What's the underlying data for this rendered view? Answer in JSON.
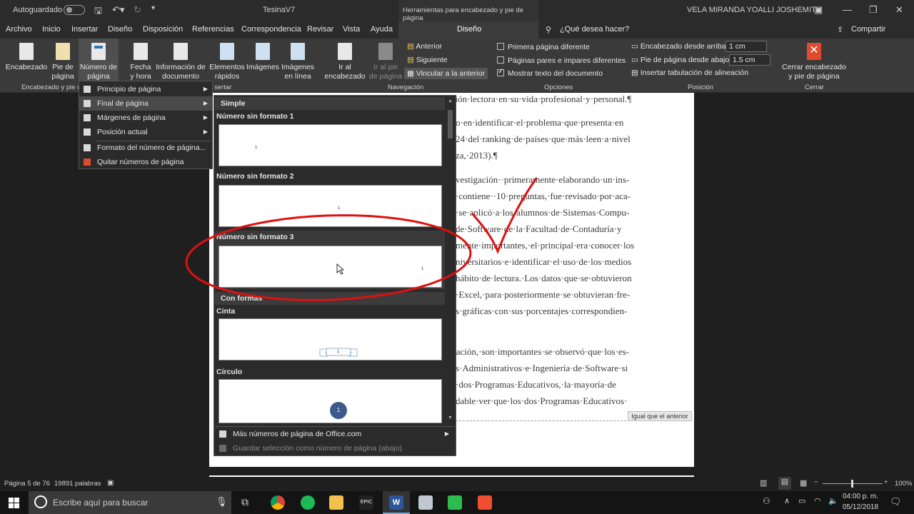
{
  "titlebar": {
    "autosave_label": "Autoguardado",
    "doc_title": "TesinaV7",
    "context_header": "Herramientas para encabezado y pie de página",
    "user_name": "VELA MIRANDA YOALLI JOSHEMITH"
  },
  "tabs": [
    "Archivo",
    "Inicio",
    "Insertar",
    "Diseño",
    "Disposición",
    "Referencias",
    "Correspondencia",
    "Revisar",
    "Vista",
    "Ayuda"
  ],
  "context_tab": "Diseño",
  "tell_me": "¿Qué desea hacer?",
  "share": "Compartir",
  "ribbon": {
    "encabezado": "Encabezado",
    "pie": "Pie de\npágina",
    "numero": "Número de\npágina",
    "fecha": "Fecha\ny hora",
    "info_doc": "Información de\ndocumento",
    "elementos": "Elementos\nrápidos",
    "imagenes": "Imágenes",
    "imagenes_linea": "Imágenes\nen línea",
    "ir_encabezado": "Ir al\nencabezado",
    "ir_pie": "Ir al pie\nde página",
    "anterior": "Anterior",
    "siguiente": "Siguiente",
    "vincular": "Vincular a la anterior",
    "primera_pagina": "Primera página diferente",
    "pares_impares": "Páginas pares e impares diferentes",
    "mostrar_texto": "Mostrar texto del documento",
    "enc_arriba_label": "Encabezado desde arriba:",
    "enc_arriba_val": "1 cm",
    "pie_abajo_label": "Pie de página desde abajo:",
    "pie_abajo_val": "1.5 cm",
    "insertar_tab": "Insertar tabulación de alineación",
    "cerrar": "Cerrar encabezado\ny pie de página",
    "groups": {
      "g1": "Encabezado y pie de",
      "g2": "sertar",
      "g3": "Navegación",
      "g4": "Opciones",
      "g5": "Posición",
      "g6": "Cerrar"
    }
  },
  "menu": [
    "Principio de página",
    "Final de página",
    "Márgenes de página",
    "Posición actual",
    "Formato del número de página...",
    "Quitar números de página"
  ],
  "gallery": {
    "section_simple": "Simple",
    "item1": "Número sin formato 1",
    "item2": "Número sin formato 2",
    "item3": "Número sin formato 3",
    "section_formas": "Con formas",
    "item4": "Cinta",
    "item5": "Círculo",
    "num": "1",
    "more": "Más números de página de Office.com",
    "save": "Guardar selección como número de página (abajo)"
  },
  "document": {
    "lines": [
      "nsión·lectora·en·su·vida·profesional·y·personal.¶",
      "o·en·identificar·el·problema·que·presenta·en",
      "24·del·ranking·de·países·que·más·leen·a·nivel",
      "za,·2013).¶",
      "vestigación··primeramente·elaborando·un·ins-",
      "·contiene··10·preguntas,·fue·revisado·por·aca-",
      "·se·aplicó·a·los·alumnos·de·Sistemas·Compu-",
      "de·Software·de·la·Facultad·de·Contaduría·y",
      "mente·importantes,·el·principal·era·conocer·los",
      "niversitarios·e·identificar·el·uso·de·los·medios",
      "hábito·de·lectura.·Los·datos·que·se·obtuvieron",
      "·Excel,·para·posteriormente·se·obtuvieran·fre-",
      "s·gráficas·con·sus·porcentajes·correspondien-",
      "cación,·son·importantes·se·observó·que·los·es-",
      "s·Administrativos·e·Ingeniería·de·Software·si",
      "·dos·Programas·Educativos,·la·mayoría·de",
      "dable·ver·que·los·dos·Programas·Educativos·"
    ],
    "footer_tag": "Igual que el anterior"
  },
  "status": {
    "page": "Página 5 de 76",
    "words": "19891 palabras",
    "zoom": "100%"
  },
  "taskbar": {
    "search": "Escribe aquí para buscar",
    "time": "04:00 p. m.",
    "date": "05/12/2018"
  },
  "colors": {
    "annotation_red": "#e01010",
    "accent_blue": "#2b579a"
  }
}
